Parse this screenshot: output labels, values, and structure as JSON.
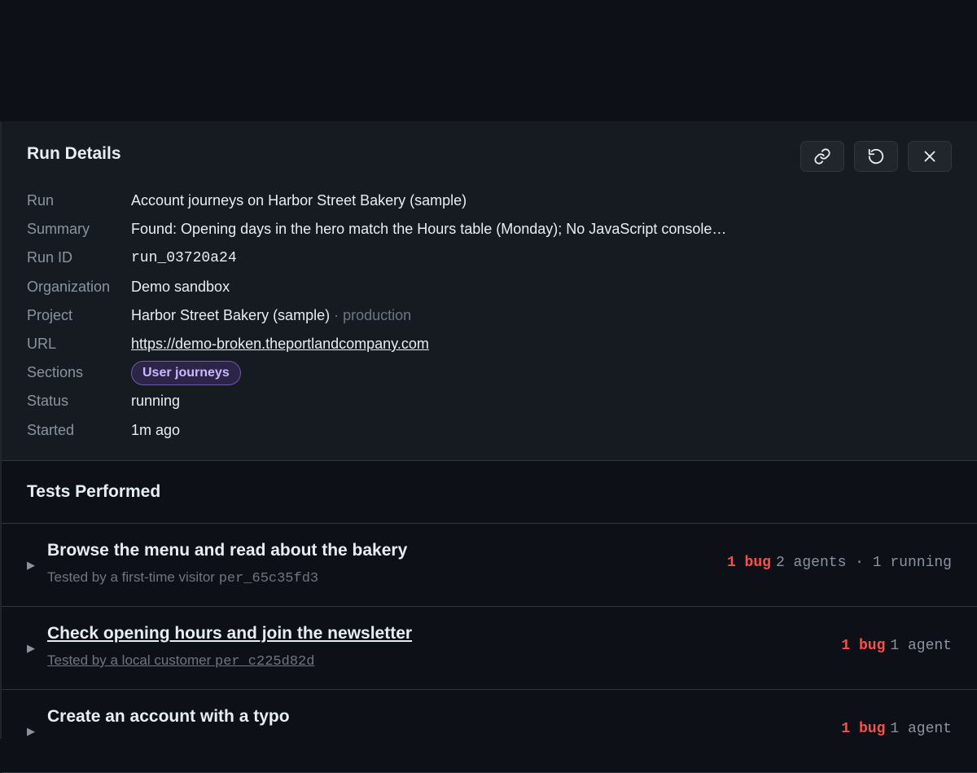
{
  "panel": {
    "title": "Run Details",
    "actions": [
      {
        "icon": "link-icon"
      },
      {
        "icon": "refresh-icon"
      },
      {
        "icon": "close-icon"
      }
    ],
    "fields": {
      "run": {
        "label": "Run",
        "value": "Account journeys on Harbor Street Bakery (sample)"
      },
      "summary": {
        "label": "Summary",
        "value": "Found: Opening days in the hero match the Hours table (Monday); No JavaScript console…"
      },
      "run_id": {
        "label": "Run ID",
        "value": "run_03720a24"
      },
      "organization": {
        "label": "Organization",
        "value": "Demo sandbox"
      },
      "project": {
        "label": "Project",
        "value": "Harbor Street Bakery (sample)",
        "environment": "· production"
      },
      "url": {
        "label": "URL",
        "value": "https://demo-broken.theportlandcompany.com"
      },
      "sections": {
        "label": "Sections",
        "value": "User journeys"
      },
      "status": {
        "label": "Status",
        "value": "running"
      },
      "started": {
        "label": "Started",
        "value": "1m ago"
      }
    }
  },
  "tests": {
    "title": "Tests Performed",
    "items": [
      {
        "title": "Browse the menu and read about the bakery",
        "tested_by": "Tested by a first-time visitor",
        "persona_id": "per_65c35fd3",
        "bugs": "1 bug",
        "agents": "2 agents · 1 running"
      },
      {
        "title": "Check opening hours and join the newsletter",
        "tested_by": "Tested by a local customer",
        "persona_id": "per_c225d82d",
        "bugs": "1 bug",
        "agents": "1 agent"
      },
      {
        "title": "Create an account with a typo",
        "tested_by": "",
        "persona_id": "",
        "bugs": "1 bug",
        "agents": "1 agent"
      }
    ]
  },
  "colors": {
    "bug": "#f85149",
    "link": "#58a6ff",
    "badge": "#c9b8ff"
  }
}
